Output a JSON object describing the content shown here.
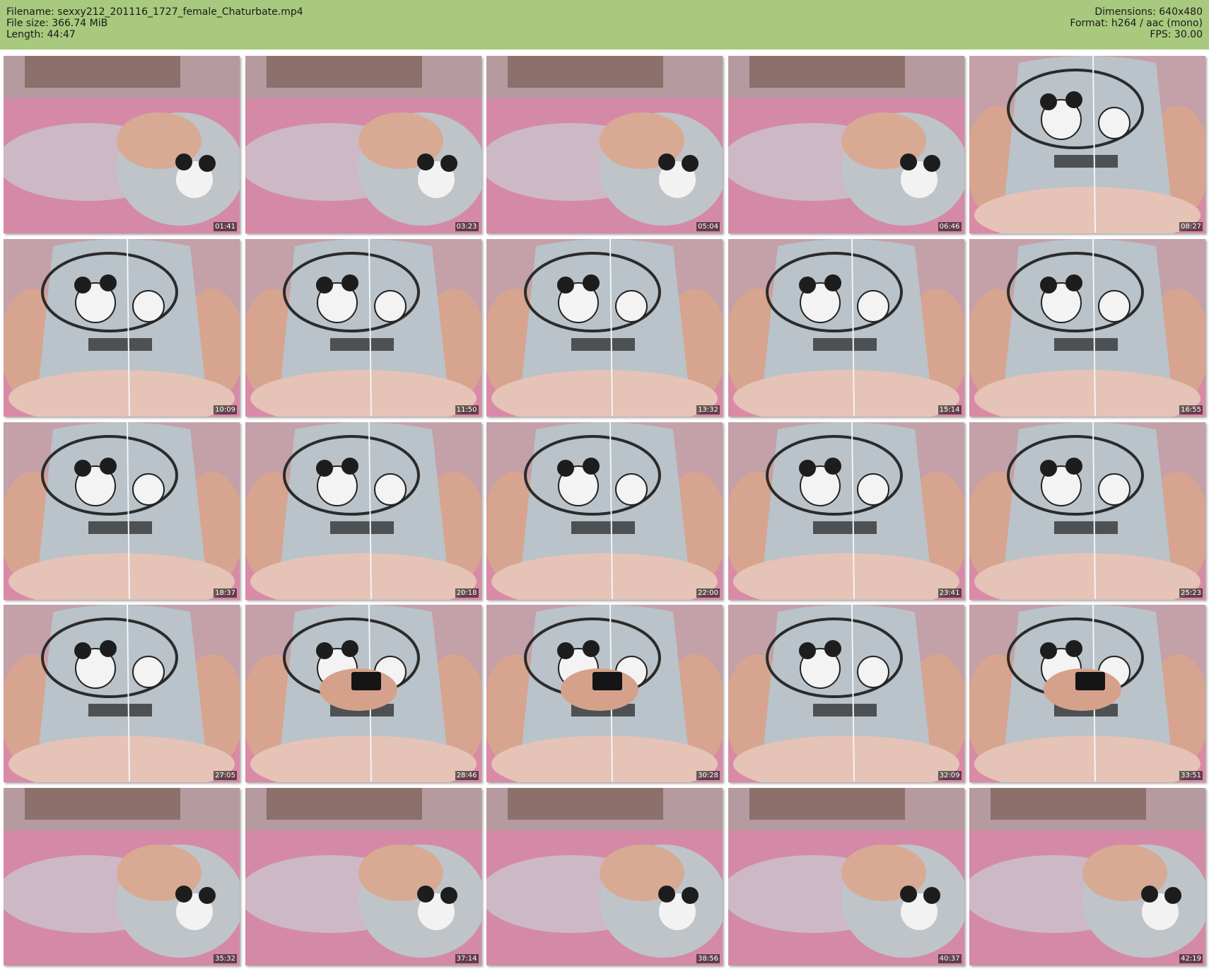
{
  "info": {
    "filename_line": "Filename: sexxy212_201116_1727_female_Chaturbate.mp4",
    "filesize_line": "File size: 366.74 MiB",
    "length_line": "Length: 44:47",
    "dimensions_line": "Dimensions: 640x480",
    "format_line": "Format: h264 / aac (mono)",
    "fps_line": "FPS: 30.00"
  },
  "colors": {
    "header_bg": "#a9c97f"
  },
  "thumbnails": [
    {
      "timestamp": "01:41",
      "scene": "lying"
    },
    {
      "timestamp": "03:23",
      "scene": "lying"
    },
    {
      "timestamp": "05:04",
      "scene": "lying"
    },
    {
      "timestamp": "06:46",
      "scene": "lying"
    },
    {
      "timestamp": "08:27",
      "scene": "sitting"
    },
    {
      "timestamp": "10:09",
      "scene": "sitting"
    },
    {
      "timestamp": "11:50",
      "scene": "sitting"
    },
    {
      "timestamp": "13:32",
      "scene": "sitting"
    },
    {
      "timestamp": "15:14",
      "scene": "sitting"
    },
    {
      "timestamp": "16:55",
      "scene": "sitting"
    },
    {
      "timestamp": "18:37",
      "scene": "sitting"
    },
    {
      "timestamp": "20:18",
      "scene": "sitting"
    },
    {
      "timestamp": "22:00",
      "scene": "sitting"
    },
    {
      "timestamp": "23:41",
      "scene": "sitting"
    },
    {
      "timestamp": "25:23",
      "scene": "sitting"
    },
    {
      "timestamp": "27:05",
      "scene": "sitting"
    },
    {
      "timestamp": "28:46",
      "scene": "sitting-phone"
    },
    {
      "timestamp": "30:28",
      "scene": "sitting-phone"
    },
    {
      "timestamp": "32:09",
      "scene": "sitting"
    },
    {
      "timestamp": "33:51",
      "scene": "sitting-phone"
    },
    {
      "timestamp": "35:32",
      "scene": "lying"
    },
    {
      "timestamp": "37:14",
      "scene": "lying"
    },
    {
      "timestamp": "38:56",
      "scene": "lying"
    },
    {
      "timestamp": "40:37",
      "scene": "lying"
    },
    {
      "timestamp": "42:19",
      "scene": "lying"
    }
  ]
}
